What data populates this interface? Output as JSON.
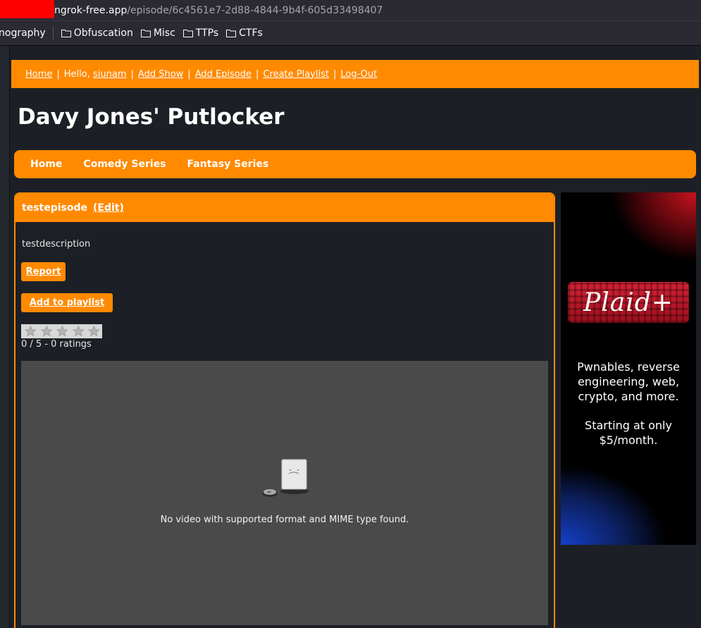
{
  "browser": {
    "url_host": "ngrok-free.app",
    "url_path": "/episode/6c4561e7-2d88-4844-9b4f-605d33498407",
    "bookmarks": [
      "nography",
      "Obfuscation",
      "Misc",
      "TTPs",
      "CTFs"
    ]
  },
  "topbar": {
    "home": "Home",
    "hello": "Hello,",
    "username": "siunam",
    "add_show": "Add Show",
    "add_episode": "Add Episode",
    "create_playlist": "Create Playlist",
    "logout": "Log-Out"
  },
  "site_title": "Davy Jones' Putlocker",
  "nav": [
    "Home",
    "Comedy Series",
    "Fantasy Series"
  ],
  "episode": {
    "title": "testepisode",
    "edit_label": "(Edit)",
    "description": "testdescription",
    "report_label": "Report",
    "add_playlist_label": "Add to playlist",
    "rating_value": 0,
    "rating_max": 5,
    "rating_text": "0 / 5 - 0 ratings"
  },
  "video": {
    "message": "No video with supported format and MIME type found."
  },
  "ad": {
    "logo": "Plaid+",
    "line1": "Pwnables, reverse engineering, web, crypto, and more.",
    "line2": "Starting at only $5/month."
  },
  "colors": {
    "accent": "#ff8a00",
    "background": "#1c2026"
  }
}
